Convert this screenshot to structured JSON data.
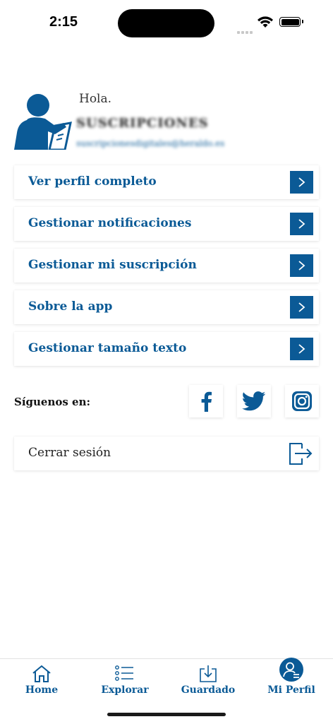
{
  "status_bar": {
    "time": "2:15"
  },
  "profile": {
    "greeting": "Hola.",
    "username": "SUSCRIPCIONES",
    "email": "suscripcionesdigitales@heraldo.es"
  },
  "menu": {
    "items": [
      {
        "label": "Ver perfil completo"
      },
      {
        "label": "Gestionar notificaciones"
      },
      {
        "label": "Gestionar mi suscripción"
      },
      {
        "label": "Sobre la app"
      },
      {
        "label": "Gestionar tamaño texto"
      }
    ]
  },
  "social": {
    "label": "Síguenos en:",
    "networks": [
      "facebook-icon",
      "twitter-icon",
      "instagram-icon"
    ]
  },
  "logout": {
    "label": "Cerrar sesión"
  },
  "tabbar": {
    "tabs": [
      {
        "label": "Home",
        "icon": "home-icon"
      },
      {
        "label": "Explorar",
        "icon": "list-icon"
      },
      {
        "label": "Guardado",
        "icon": "save-icon"
      },
      {
        "label": "Mi Perfil",
        "icon": "profile-icon"
      }
    ]
  },
  "colors": {
    "accent": "#0b5a96",
    "background": "#ffffff"
  }
}
